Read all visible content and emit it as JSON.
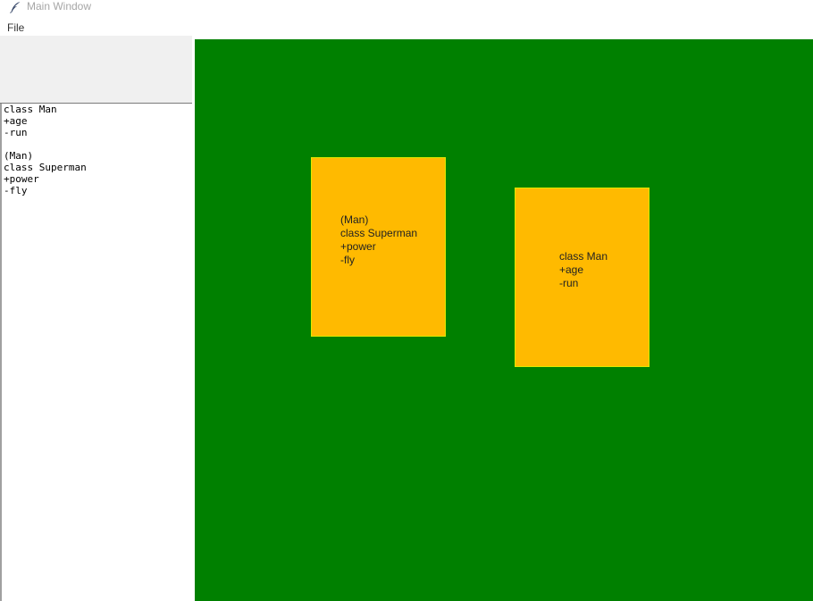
{
  "window": {
    "title": "Main Window",
    "icon": "feather-icon"
  },
  "menubar": {
    "file_label": "File"
  },
  "editor": {
    "text": "class Man\n+age\n-run\n\n(Man)\nclass Superman\n+power\n-fly"
  },
  "canvas": {
    "background_color": "#008000",
    "cards": [
      {
        "text": "(Man)\nclass Superman\n+power\n-fly",
        "color": "#ffba00"
      },
      {
        "text": "class Man\n+age\n-run",
        "color": "#ffba00"
      }
    ]
  }
}
